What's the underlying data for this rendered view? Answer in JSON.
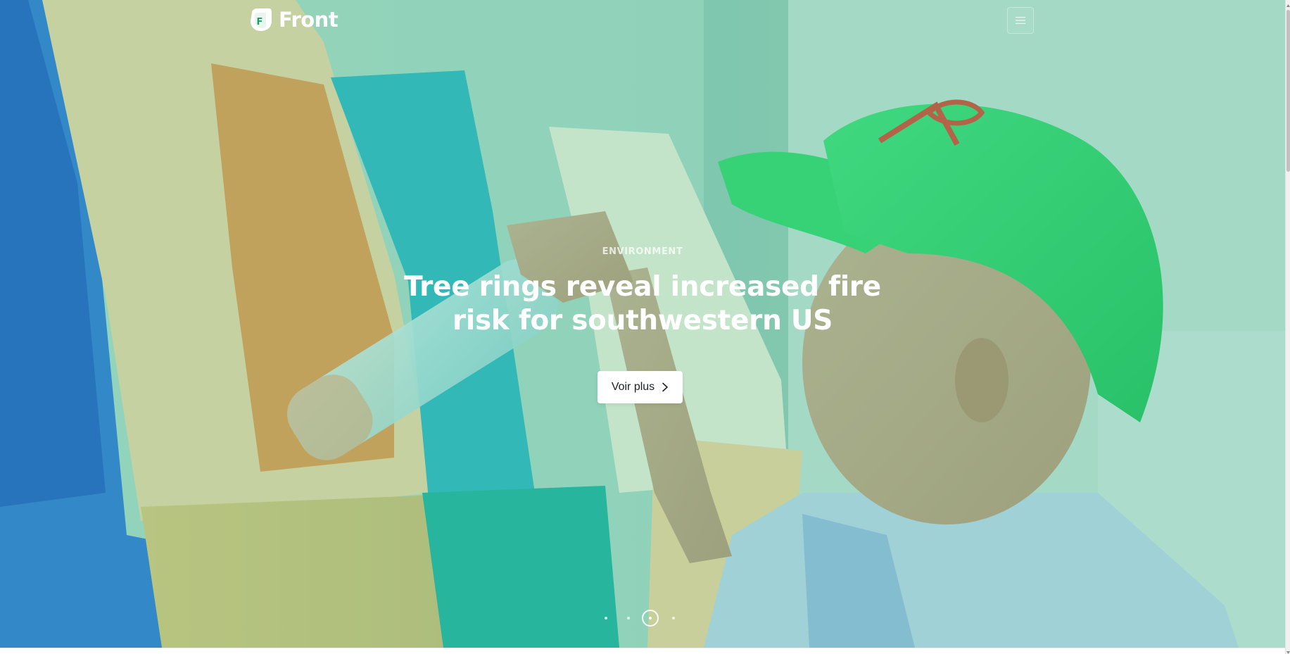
{
  "header": {
    "brand_name": "Front",
    "brand_letter": "F",
    "menu_toggle_icon": "hamburger-icon"
  },
  "hero": {
    "category": "ENVIRONMENT",
    "title": "Tree rings reveal increased fire risk for southwestern US",
    "cta_label": "Voir plus",
    "cta_icon": "chevron-right-icon",
    "slides_total": 4,
    "active_slide": 3
  },
  "colors": {
    "brand_accent": "#1f9d6b",
    "overlay_tint": "#46be96",
    "cta_background": "#ffffff",
    "cta_text": "#1e2022"
  }
}
